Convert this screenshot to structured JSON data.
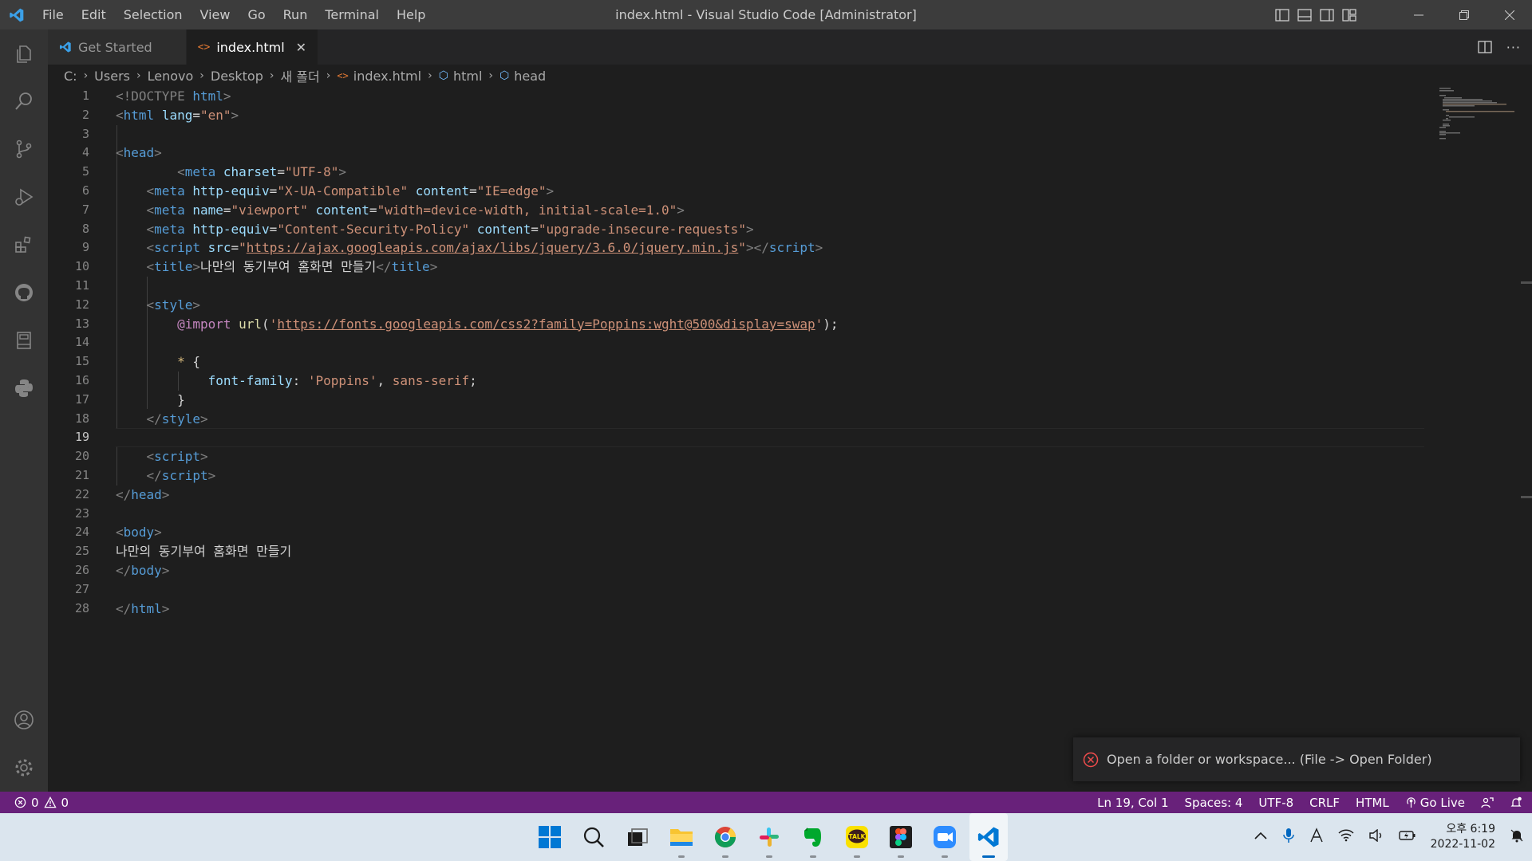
{
  "window": {
    "title": "index.html - Visual Studio Code [Administrator]",
    "menu": [
      "File",
      "Edit",
      "Selection",
      "View",
      "Go",
      "Run",
      "Terminal",
      "Help"
    ]
  },
  "tabs": [
    {
      "label": "Get Started",
      "active": false
    },
    {
      "label": "index.html",
      "active": true
    }
  ],
  "breadcrumb": [
    "C:",
    "Users",
    "Lenovo",
    "Desktop",
    "새 폴더",
    "index.html",
    "html",
    "head"
  ],
  "editor": {
    "current_line": 19,
    "line_numbers": [
      "1",
      "2",
      "3",
      "4",
      "5",
      "6",
      "7",
      "8",
      "9",
      "10",
      "11",
      "12",
      "13",
      "14",
      "15",
      "16",
      "17",
      "18",
      "19",
      "20",
      "21",
      "22",
      "23",
      "24",
      "25",
      "26",
      "27",
      "28"
    ],
    "code": {
      "l1": {
        "open": "<!DOCTYPE ",
        "kw": "html",
        "close": ">"
      },
      "l2": {
        "tag": "html",
        "attr": "lang",
        "val": "\"en\""
      },
      "l4": {
        "tag": "head"
      },
      "l5": {
        "tag": "meta",
        "attr": "charset",
        "val": "\"UTF-8\""
      },
      "l6": {
        "tag": "meta",
        "attr1": "http-equiv",
        "val1": "\"X-UA-Compatible\"",
        "attr2": "content",
        "val2": "\"IE=edge\""
      },
      "l7": {
        "tag": "meta",
        "attr1": "name",
        "val1": "\"viewport\"",
        "attr2": "content",
        "val2": "\"width=device-width, initial-scale=1.0\""
      },
      "l8": {
        "tag": "meta",
        "attr1": "http-equiv",
        "val1": "\"Content-Security-Policy\"",
        "attr2": "content",
        "val2": "\"upgrade-insecure-requests\""
      },
      "l9": {
        "tag": "script",
        "attr": "src",
        "url": "https://ajax.googleapis.com/ajax/libs/jquery/3.6.0/jquery.min.js"
      },
      "l10": {
        "tag": "title",
        "text": "나만의 동기부여 홈화면 만들기"
      },
      "l12": {
        "tag": "style"
      },
      "l13": {
        "kw": "@import",
        "fn": "url",
        "url": "https://fonts.googleapis.com/css2?family=Poppins:wght@500&display=swap"
      },
      "l15": {
        "sel": "*",
        "brace": "{"
      },
      "l16": {
        "prop": "font-family",
        "val1": "'Poppins'",
        "val2": "sans-serif"
      },
      "l17": {
        "brace": "}"
      },
      "l18": {
        "tag": "style"
      },
      "l20": {
        "tag": "script"
      },
      "l21": {
        "tag": "script"
      },
      "l22": {
        "tag": "head"
      },
      "l24": {
        "tag": "body"
      },
      "l25": {
        "text": "나만의 동기부여 홈화면 만들기"
      },
      "l26": {
        "tag": "body"
      },
      "l28": {
        "tag": "html"
      }
    }
  },
  "notification": {
    "message": "Open a folder or workspace... (File -> Open Folder)"
  },
  "statusbar": {
    "errors": "0",
    "warnings": "0",
    "position": "Ln 19, Col 1",
    "spaces": "Spaces: 4",
    "encoding": "UTF-8",
    "eol": "CRLF",
    "language": "HTML",
    "golive": "Go Live"
  },
  "taskbar": {
    "apps": [
      "start-icon",
      "search-icon",
      "task-view-icon",
      "file-explorer-icon",
      "chrome-icon",
      "slack-icon",
      "evernote-icon",
      "kakaotalk-icon",
      "figma-icon",
      "zoom-icon",
      "vscode-icon"
    ],
    "kakaotalk_label": "TALK",
    "clock_time": "오후 6:19",
    "clock_date": "2022-11-02"
  },
  "colors": {
    "statusbar": "#68217a",
    "accent": "#0078d4",
    "error": "#f14c4c"
  }
}
